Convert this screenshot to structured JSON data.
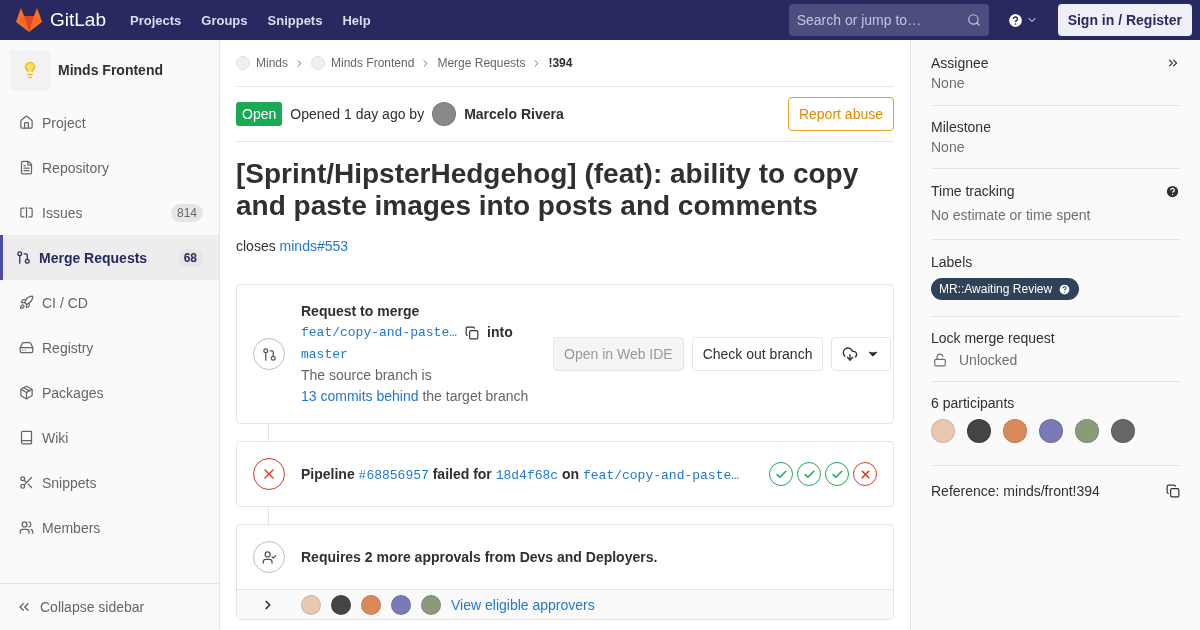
{
  "header": {
    "logo_text": "GitLab",
    "nav": [
      "Projects",
      "Groups",
      "Snippets",
      "Help"
    ],
    "search": {
      "placeholder": "Search or jump to…"
    },
    "sign_in": "Sign in / Register"
  },
  "sidebar": {
    "project_name": "Minds Frontend",
    "items": [
      {
        "label": "Project",
        "kind": "project",
        "selected": false
      },
      {
        "label": "Repository",
        "kind": "repository",
        "selected": false
      },
      {
        "label": "Issues",
        "kind": "issues",
        "count": "814",
        "selected": false
      },
      {
        "label": "Merge Requests",
        "kind": "merge",
        "count": "68",
        "selected": true
      },
      {
        "label": "CI / CD",
        "kind": "cicd",
        "selected": false
      },
      {
        "label": "Registry",
        "kind": "registry",
        "selected": false
      },
      {
        "label": "Packages",
        "kind": "packages",
        "selected": false
      },
      {
        "label": "Wiki",
        "kind": "wiki",
        "selected": false
      },
      {
        "label": "Snippets",
        "kind": "snippets",
        "selected": false
      },
      {
        "label": "Members",
        "kind": "members",
        "selected": false
      }
    ],
    "collapse": "Collapse sidebar"
  },
  "breadcrumbs": [
    {
      "label": "Minds",
      "kind": "project"
    },
    {
      "label": "Minds Frontend",
      "kind": "project"
    },
    {
      "label": "Merge Requests",
      "kind": "plain"
    },
    {
      "label": "!394",
      "kind": "current"
    }
  ],
  "status": {
    "badge": "Open",
    "text": "Opened 1 day ago by",
    "author": "Marcelo Rivera",
    "report": "Report abuse"
  },
  "title": "[Sprint/HipsterHedgehog] (feat): ability to copy and paste images into posts and comments",
  "description": {
    "text": "closes",
    "link": "minds#553"
  },
  "merge_widget": {
    "heading": "Request to merge",
    "source_branch": "feat/copy-and-paste…",
    "into": "into",
    "target_branch": "master",
    "note_before": "The source branch is",
    "note_link": "13 commits behind",
    "note_after": "the target branch",
    "buttons": [
      {
        "label": "Open in Web IDE",
        "disabled": true
      },
      {
        "label": "Check out branch",
        "disabled": false
      }
    ]
  },
  "pipeline": {
    "label": "Pipeline",
    "id": "#68856957",
    "status_text": "failed for",
    "commit": "18d4f68c",
    "on": "on",
    "branch": "feat/copy-and-paste…",
    "passed": false,
    "stages": [
      {
        "passed": true
      },
      {
        "passed": true
      },
      {
        "passed": true
      },
      {
        "passed": false
      }
    ]
  },
  "approvals": {
    "text": "Requires 2 more approvals from Devs and Deployers.",
    "link": "View eligible approvers"
  },
  "right_sidebar": {
    "assignee": {
      "title": "Assignee",
      "value": "None"
    },
    "milestone": {
      "title": "Milestone",
      "value": "None"
    },
    "time_tracking": {
      "title": "Time tracking",
      "value": "No estimate or time spent"
    },
    "labels": {
      "title": "Labels",
      "items": [
        {
          "text": "MR::Awaiting Review",
          "color": "#2f4358"
        }
      ]
    },
    "lock": {
      "title": "Lock merge request",
      "value": "Unlocked"
    },
    "participants": {
      "title": "6 participants"
    },
    "reference": "Reference: minds/front!394"
  }
}
